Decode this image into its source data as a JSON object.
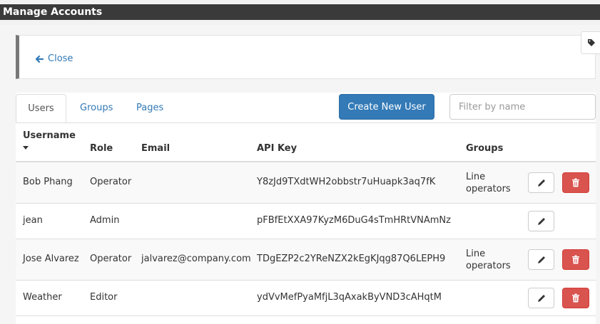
{
  "window": {
    "title": "Manage Accounts"
  },
  "close_panel": {
    "close_label": "Close"
  },
  "tabs": [
    {
      "label": "Users",
      "active": true
    },
    {
      "label": "Groups",
      "active": false
    },
    {
      "label": "Pages",
      "active": false
    }
  ],
  "toolbar": {
    "create_label": "Create New User",
    "filter_placeholder": "Filter by name",
    "filter_value": ""
  },
  "table": {
    "columns": [
      "Username",
      "Role",
      "Email",
      "API Key",
      "Groups"
    ],
    "sort": {
      "column": "Username",
      "direction": "descending"
    },
    "rows": [
      {
        "username": "Bob Phang",
        "role": "Operator",
        "email": "",
        "api_key": "Y8zJd9TXdtWH2obbstr7uHuapk3aq7fK",
        "groups": "Line operators",
        "can_delete": true
      },
      {
        "username": "jean",
        "role": "Admin",
        "email": "",
        "api_key": "pFBfEtXXA97KyzM6DuG4sTmHRtVNAmNz",
        "groups": "",
        "can_delete": false
      },
      {
        "username": "Jose Alvarez",
        "role": "Operator",
        "email": "jalvarez@company.com",
        "api_key": "TDgEZP2c2YReNZX2kEgKJqg87Q6LEPH9",
        "groups": "Line operators",
        "can_delete": true
      },
      {
        "username": "Weather",
        "role": "Editor",
        "email": "",
        "api_key": "ydVvMefPyaMfjL3qAxakByVND3cAHqtM",
        "groups": "",
        "can_delete": true
      }
    ]
  },
  "icons": {
    "close": "arrow-left-icon",
    "tag": "tag-icon",
    "edit": "pencil-icon",
    "delete": "trash-icon"
  },
  "colors": {
    "title_bar": "#3a3a3a",
    "accent": "#337ab7",
    "danger": "#d9534f",
    "panel_border": "#787878"
  }
}
